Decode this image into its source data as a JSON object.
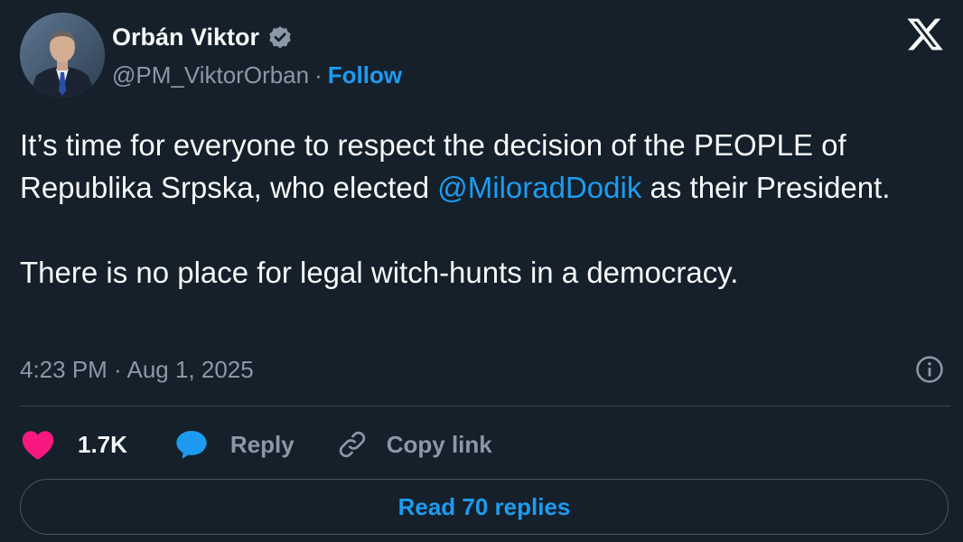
{
  "author": {
    "display_name": "Orbán Viktor",
    "handle": "@PM_ViktorOrban",
    "separator": "·",
    "follow_label": "Follow"
  },
  "tweet": {
    "line1_before": "It’s time for everyone to respect the decision of the PEOPLE of Republika Srpska, who elected ",
    "mention": "@MiloradDodik",
    "line1_after": " as their President.",
    "paragraph2": "There is no place for legal witch-hunts in a democracy.",
    "timestamp": "4:23 PM · Aug 1, 2025"
  },
  "actions": {
    "like_count": "1.7K",
    "reply_label": "Reply",
    "copy_link_label": "Copy link"
  },
  "read_replies_label": "Read 70 replies",
  "colors": {
    "background": "#15202b",
    "accent": "#1d9bf0",
    "like": "#f91880",
    "muted": "#8b98a5",
    "text": "#f7f9f9"
  },
  "icons": [
    "verified-badge-icon",
    "x-logo-icon",
    "info-icon",
    "heart-icon",
    "reply-bubble-icon",
    "link-icon"
  ]
}
